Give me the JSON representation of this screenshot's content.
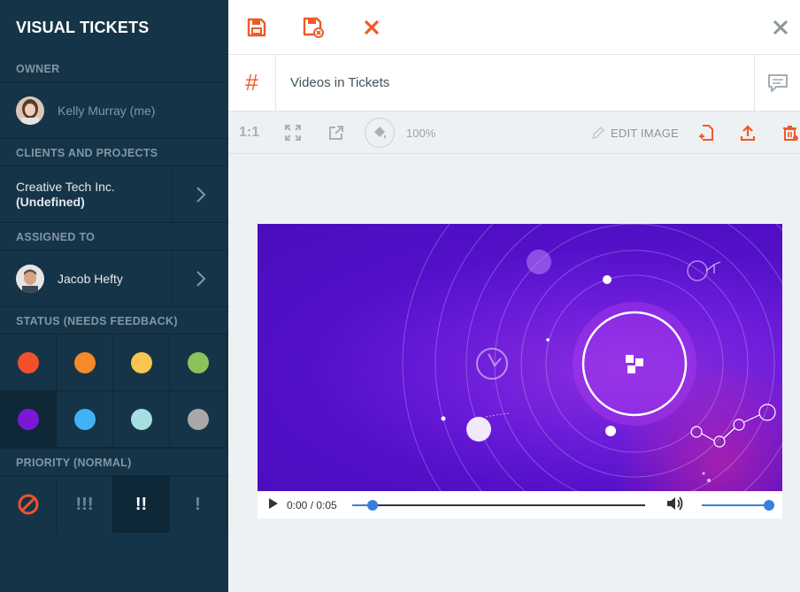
{
  "sidebar": {
    "app_title": "VISUAL TICKETS",
    "owner_heading": "OWNER",
    "owner_name": "Kelly Murray (me)",
    "clients_heading": "CLIENTS AND PROJECTS",
    "client_name": "Creative Tech Inc.",
    "project_name": "(Undefined)",
    "assigned_heading": "ASSIGNED TO",
    "assignee_name": "Jacob Hefty",
    "status_heading": "STATUS (NEEDS FEEDBACK)",
    "status_colors": [
      "#f2502c",
      "#f7892a",
      "#f7c551",
      "#8bc35a",
      "#7d17d6",
      "#40b3f5",
      "#a5dfe1",
      "#a8a8a8"
    ],
    "selected_status_index": 4,
    "priority_heading": "PRIORITY (NORMAL)",
    "priority_labels": [
      "⃠",
      "!!!",
      "!!",
      "!"
    ],
    "selected_priority_index": 2
  },
  "main": {
    "ticket_hash": "#",
    "ticket_title": "Videos in Tickets",
    "image_toolbar": {
      "ratio_label": "1:1",
      "zoom_label": "100%",
      "edit_label": "EDIT IMAGE"
    },
    "video": {
      "time_label": "0:00 / 0:05",
      "progress": 0.07,
      "volume": 1.0
    }
  },
  "colors": {
    "sidebar_bg": "#163447",
    "accent": "#f05a28",
    "muted": "#8197a4"
  }
}
